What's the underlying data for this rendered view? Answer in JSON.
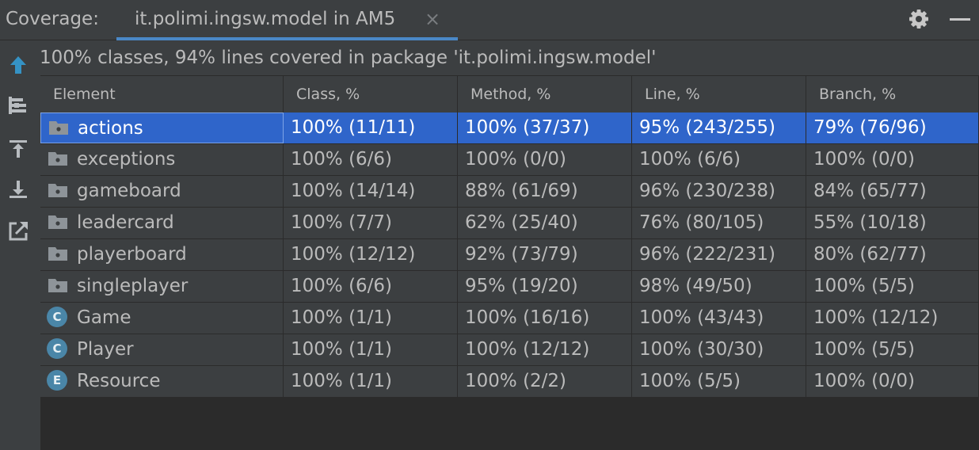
{
  "header": {
    "label": "Coverage:",
    "tab_title": "it.polimi.ingsw.model in AM5",
    "tab_close": "×"
  },
  "summary": "100% classes, 94% lines covered in package 'it.polimi.ingsw.model'",
  "columns": [
    "Element",
    "Class, %",
    "Method, %",
    "Line, %",
    "Branch, %"
  ],
  "rows": [
    {
      "name": "actions",
      "icon": "folder-icon",
      "class": "100% (11/11)",
      "method": "100% (37/37)",
      "line": "95% (243/255)",
      "branch": "79% (76/96)",
      "selected": true
    },
    {
      "name": "exceptions",
      "icon": "folder-icon",
      "class": "100% (6/6)",
      "method": "100% (0/0)",
      "line": "100% (6/6)",
      "branch": "100% (0/0)"
    },
    {
      "name": "gameboard",
      "icon": "folder-icon",
      "class": "100% (14/14)",
      "method": "88% (61/69)",
      "line": "96% (230/238)",
      "branch": "84% (65/77)"
    },
    {
      "name": "leadercard",
      "icon": "folder-icon",
      "class": "100% (7/7)",
      "method": "62% (25/40)",
      "line": "76% (80/105)",
      "branch": "55% (10/18)"
    },
    {
      "name": "playerboard",
      "icon": "folder-icon",
      "class": "100% (12/12)",
      "method": "92% (73/79)",
      "line": "96% (222/231)",
      "branch": "80% (62/77)"
    },
    {
      "name": "singleplayer",
      "icon": "folder-icon",
      "class": "100% (6/6)",
      "method": "95% (19/20)",
      "line": "98% (49/50)",
      "branch": "100% (5/5)"
    },
    {
      "name": "Game",
      "icon": "class-icon",
      "badge": "C",
      "class": "100% (1/1)",
      "method": "100% (16/16)",
      "line": "100% (43/43)",
      "branch": "100% (12/12)"
    },
    {
      "name": "Player",
      "icon": "class-icon",
      "badge": "C",
      "class": "100% (1/1)",
      "method": "100% (12/12)",
      "line": "100% (30/30)",
      "branch": "100% (5/5)"
    },
    {
      "name": "Resource",
      "icon": "enum-icon",
      "badge": "E",
      "class": "100% (1/1)",
      "method": "100% (2/2)",
      "line": "100% (5/5)",
      "branch": "100% (0/0)"
    }
  ],
  "colors": {
    "background": "#3c3f41",
    "grid": "#2b2b2b",
    "selection": "#2f65ca",
    "tab_underline": "#4a88c7",
    "accent_icon": "#3592c4"
  }
}
